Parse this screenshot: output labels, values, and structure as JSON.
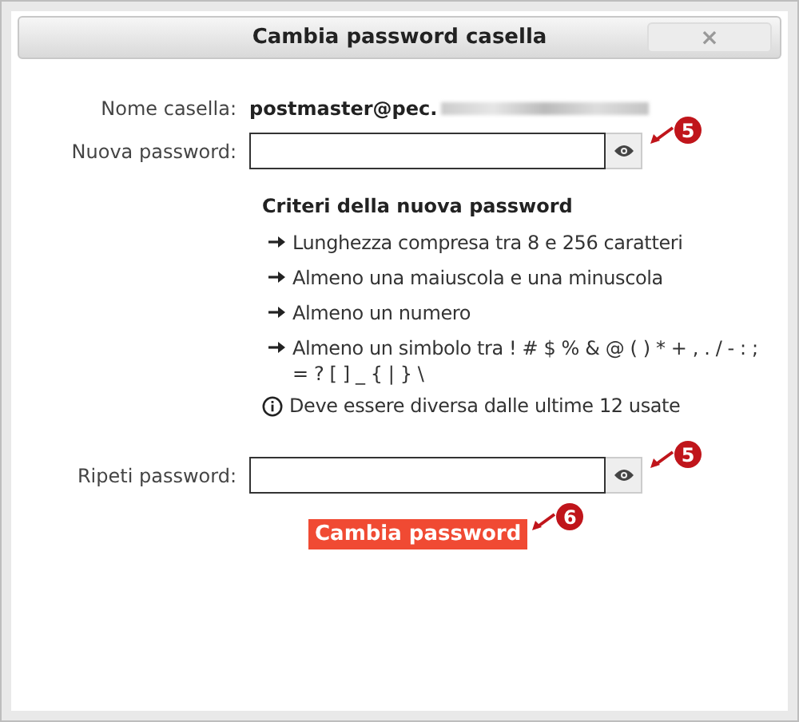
{
  "window": {
    "title": "Cambia password casella",
    "close": "×"
  },
  "mailbox": {
    "label": "Nome casella:",
    "value": "postmaster@pec.",
    "redacted": true
  },
  "new_password": {
    "label": "Nuova password:",
    "callout": "5"
  },
  "criteria": {
    "title": "Criteri della nuova password",
    "items": [
      {
        "kind": "rule",
        "text": "Lunghezza compresa tra 8 e 256 caratteri"
      },
      {
        "kind": "rule",
        "text": "Almeno una maiuscola e una minuscola"
      },
      {
        "kind": "rule",
        "text": "Almeno un numero"
      },
      {
        "kind": "rule",
        "text": "Almeno un simbolo tra ! # $ % & @ ( ) * + , . / - : ; = ? [ ] _ { | } \\"
      },
      {
        "kind": "note",
        "text": "Deve essere diversa dalle ultime 12 usate"
      }
    ]
  },
  "repeat_password": {
    "label": "Ripeti password:",
    "callout": "5"
  },
  "submit": {
    "label": "Cambia password",
    "callout": "6"
  }
}
